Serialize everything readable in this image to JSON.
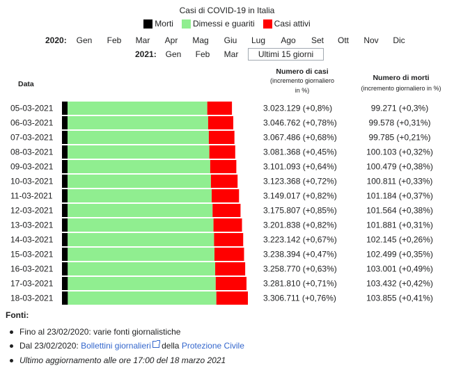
{
  "title": "Casi di COVID-19 in Italia",
  "legend": [
    {
      "label": "Morti",
      "color": "#000000"
    },
    {
      "label": "Dimessi e guariti",
      "color": "#90ee90"
    },
    {
      "label": "Casi attivi",
      "color": "#ff0000"
    }
  ],
  "year_2020": {
    "label": "2020:",
    "months": [
      "Gen",
      "Feb",
      "Mar",
      "Apr",
      "Mag",
      "Giu",
      "Lug",
      "Ago",
      "Set",
      "Ott",
      "Nov",
      "Dic"
    ]
  },
  "year_2021": {
    "label": "2021:",
    "months": [
      "Gen",
      "Feb",
      "Mar"
    ],
    "last_button": "Ultimi 15 giorni"
  },
  "headers": {
    "date": "Data",
    "cases_title": "Numero di casi",
    "cases_sub1": "(incremento giornaliero",
    "cases_sub2": "in %)",
    "deaths_title": "Numero di morti",
    "deaths_sub": "(incremento giornaliero in %)"
  },
  "chart_data": {
    "type": "bar",
    "stacked": true,
    "orientation": "horizontal",
    "categories": [
      "05-03-2021",
      "06-03-2021",
      "07-03-2021",
      "08-03-2021",
      "09-03-2021",
      "10-03-2021",
      "11-03-2021",
      "12-03-2021",
      "13-03-2021",
      "14-03-2021",
      "15-03-2021",
      "16-03-2021",
      "17-03-2021",
      "18-03-2021"
    ],
    "series": [
      {
        "name": "Morti",
        "color": "#000000",
        "values": [
          99271,
          99578,
          99785,
          100103,
          100479,
          100811,
          101184,
          101564,
          101881,
          102145,
          102499,
          103001,
          103432,
          103855
        ]
      },
      {
        "name": "Dimessi e guariti",
        "color": "#90ee90",
        "values": [
          2485000,
          2500000,
          2512000,
          2521000,
          2536000,
          2548000,
          2562000,
          2577000,
          2593000,
          2603000,
          2610000,
          2622000,
          2631000,
          2642000
        ]
      },
      {
        "name": "Casi attivi",
        "color": "#ff0000",
        "values": [
          438858,
          447184,
          455701,
          460265,
          464614,
          474557,
          485833,
          497243,
          506957,
          517997,
          525895,
          533769,
          547378,
          560861
        ]
      }
    ],
    "totals": [
      3023129,
      3046762,
      3067486,
      3081368,
      3101093,
      3123368,
      3149017,
      3175807,
      3201838,
      3223142,
      3238394,
      3258770,
      3281810,
      3306711
    ],
    "xlim": [
      0,
      3306711
    ],
    "cases_text": [
      "3.023.129 (+0,8%)",
      "3.046.762 (+0,78%)",
      "3.067.486 (+0,68%)",
      "3.081.368 (+0,45%)",
      "3.101.093 (+0,64%)",
      "3.123.368 (+0,72%)",
      "3.149.017 (+0,82%)",
      "3.175.807 (+0,85%)",
      "3.201.838 (+0,82%)",
      "3.223.142 (+0,67%)",
      "3.238.394 (+0,47%)",
      "3.258.770 (+0,63%)",
      "3.281.810 (+0,71%)",
      "3.306.711 (+0,76%)"
    ],
    "deaths_text": [
      "99.271 (+0,3%)",
      "99.578 (+0,31%)",
      "99.785 (+0,21%)",
      "100.103 (+0,32%)",
      "100.479 (+0,38%)",
      "100.811 (+0,33%)",
      "101.184 (+0,37%)",
      "101.564 (+0,38%)",
      "101.881 (+0,31%)",
      "102.145 (+0,26%)",
      "102.499 (+0,35%)",
      "103.001 (+0,49%)",
      "103.432 (+0,42%)",
      "103.855 (+0,41%)"
    ]
  },
  "sources": {
    "title": "Fonti:",
    "line1": "Fino al 23/02/2020: varie fonti giornalistiche",
    "line2_prefix": "Dal 23/02/2020: ",
    "line2_link1": "Bollettini giornalieri",
    "line2_mid": " della ",
    "line2_link2": "Protezione Civile",
    "line3": "Ultimo aggiornamento alle ore 17:00 del 18 marzo 2021"
  }
}
